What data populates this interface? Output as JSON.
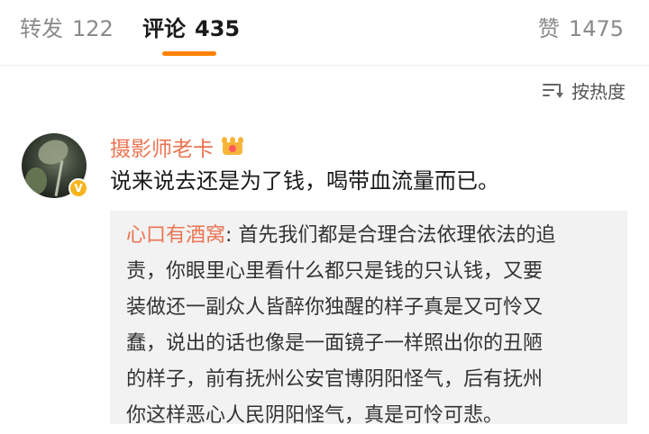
{
  "tabs": {
    "repost": {
      "label": "转发",
      "count": "122"
    },
    "comments": {
      "label": "评论",
      "count": "435"
    },
    "likes": {
      "label": "赞",
      "count": "1475"
    }
  },
  "sort": {
    "label": "按热度",
    "icon": "sort-icon"
  },
  "comment": {
    "username": "摄影师老卡",
    "verified_badge": "V",
    "badge_icon": "crown-icon",
    "text": "说来说去还是为了钱，喝带血流量而已。",
    "reply": {
      "author": "心口有酒窝",
      "separator": ":",
      "lines": [
        " 首先我们都是合理合法依理依法的追",
        "责，你眼里心里看什么都只是钱的只认钱，又要",
        "装做还一副众人皆醉你独醒的样子真是又可怜又",
        "蠢，说出的话也像是一面镜子一样照出你的丑陋",
        "的样子，前有抚州公安官博阴阳怪气，后有抚州",
        "你这样恶心人民阴阳怪气，真是可怜可悲。"
      ]
    }
  },
  "colors": {
    "accent": "#ff8200",
    "username": "#eb7350",
    "reply_bg": "#f2f2f2"
  }
}
